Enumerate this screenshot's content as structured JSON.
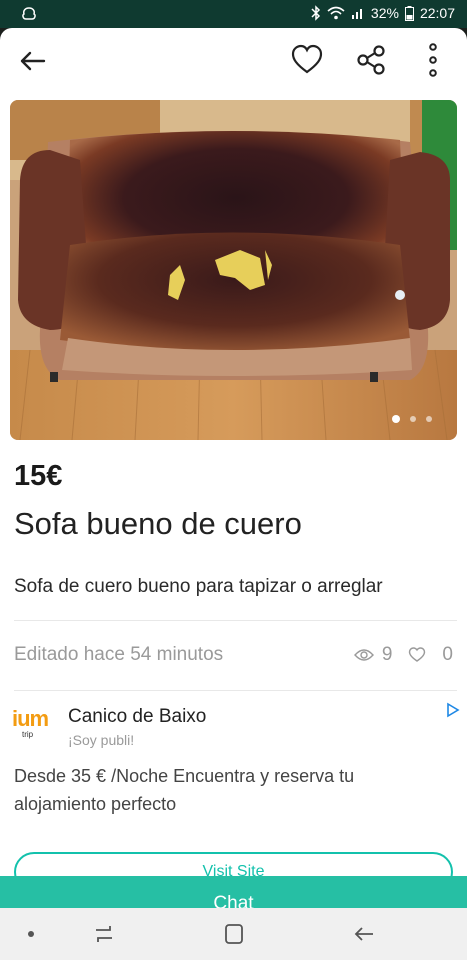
{
  "status_bar": {
    "battery": "32%",
    "time": "22:07"
  },
  "listing": {
    "price": "15€",
    "title": "Sofa bueno de cuero",
    "description": "Sofa de cuero bueno para tapizar o arreglar",
    "edited": "Editado hace 54 minutos",
    "views": "9",
    "favorites": "0",
    "photo_index": 1,
    "photo_count": 3
  },
  "ad": {
    "brand": "ium",
    "brand_sub": "trip",
    "title": "Canico de Baixo",
    "subtitle": "¡Soy publi!",
    "text": "Desde 35 € /Noche Encuentra y reserva tu alojamiento perfecto",
    "cta": "Visit Site"
  },
  "chat_button": "Chat",
  "colors": {
    "accent": "#26bfa4",
    "status_bar": "#0f3a30"
  }
}
